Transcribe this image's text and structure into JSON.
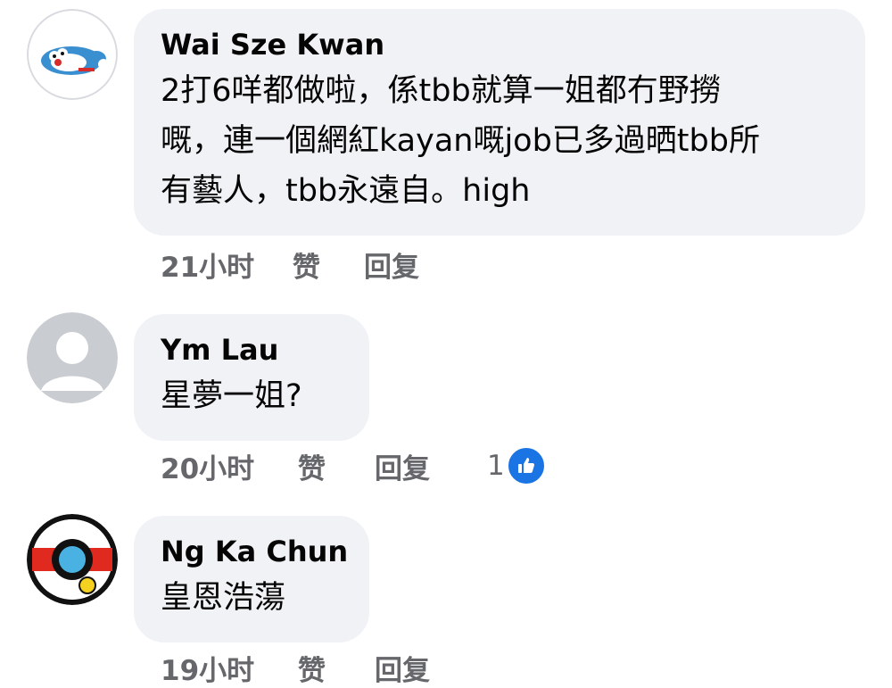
{
  "comments": [
    {
      "author": "Wai Sze Kwan",
      "text_lines": [
        "2打6咩都做啦，係tbb就算一姐都冇野撈",
        "嘅，連一個網紅kayan嘅job已多過晒tbb所",
        "有藝人，tbb永遠自。high"
      ],
      "time": "21小时",
      "like_label": "赞",
      "reply_label": "回复",
      "avatar_icon": "doraemon-avatar-icon"
    },
    {
      "author": "Ym Lau",
      "text_lines": [
        "星夢一姐?"
      ],
      "time": "20小时",
      "like_label": "赞",
      "reply_label": "回复",
      "reaction_count": "1",
      "reaction_icon": "thumbs-up-icon",
      "avatar_icon": "default-profile-icon"
    },
    {
      "author": "Ng Ka Chun",
      "text_lines": [
        "皇恩浩蕩"
      ],
      "time": "19小时",
      "like_label": "赞",
      "reply_label": "回复",
      "avatar_icon": "red-emblem-avatar-icon"
    }
  ],
  "colors": {
    "bubble_bg": "#f0f2f5",
    "meta_text": "#65676b",
    "like_blue": "#1b74e4"
  }
}
